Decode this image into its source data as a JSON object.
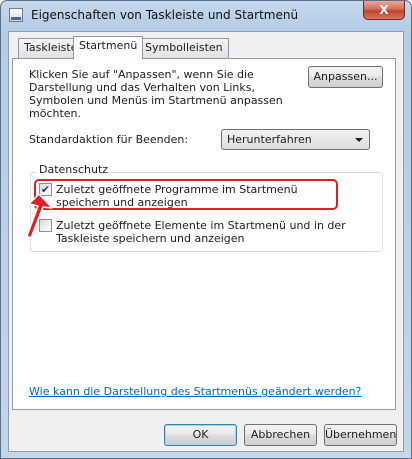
{
  "window": {
    "title": "Eigenschaften von Taskleiste und Startmenü",
    "close_label": "X"
  },
  "tabs": [
    {
      "label": "Taskleiste",
      "active": false
    },
    {
      "label": "Startmenü",
      "active": true
    },
    {
      "label": "Symbolleisten",
      "active": false
    }
  ],
  "startmenu": {
    "description": "Klicken Sie auf \"Anpassen\", wenn Sie die Darstellung und das Verhalten von Links, Symbolen und Menüs im Startmenü anpassen möchten.",
    "customize_label": "Anpassen...",
    "default_action_label": "Standardaktion für Beenden:",
    "default_action_value": "Herunterfahren"
  },
  "privacy": {
    "title": "Datenschutz",
    "store_programs": {
      "label": "Zuletzt geöffnete Programme im Startmenü speichern und anzeigen",
      "checked": true
    },
    "store_items": {
      "label": "Zuletzt geöffnete Elemente im Startmenü und in der Taskleiste speichern und anzeigen",
      "checked": false
    }
  },
  "help_link": "Wie kann die Darstellung des Startmenüs geändert werden?",
  "footer": {
    "ok": "OK",
    "cancel": "Abbrechen",
    "apply": "Übernehmen"
  },
  "colors": {
    "highlight": "#e02020",
    "link": "#0066cc"
  }
}
